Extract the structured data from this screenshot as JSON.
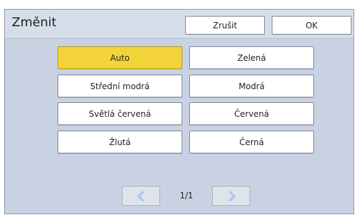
{
  "dialog": {
    "title": "Změnit",
    "cancel_label": "Zrušit",
    "ok_label": "OK"
  },
  "options": [
    {
      "label": "Auto",
      "selected": true
    },
    {
      "label": "Zelená",
      "selected": false
    },
    {
      "label": "Střední modrá",
      "selected": false
    },
    {
      "label": "Modrá",
      "selected": false
    },
    {
      "label": "Světlá červená",
      "selected": false
    },
    {
      "label": "Červená",
      "selected": false
    },
    {
      "label": "Žlutá",
      "selected": false
    },
    {
      "label": "Černá",
      "selected": false
    }
  ],
  "pagination": {
    "page_indicator": "1/1",
    "prev_icon": "chevron-left-icon",
    "next_icon": "chevron-right-icon"
  },
  "colors": {
    "selected": "#f2d43a",
    "panel": "#c8d2e2",
    "arrow": "#a9c3ea"
  }
}
